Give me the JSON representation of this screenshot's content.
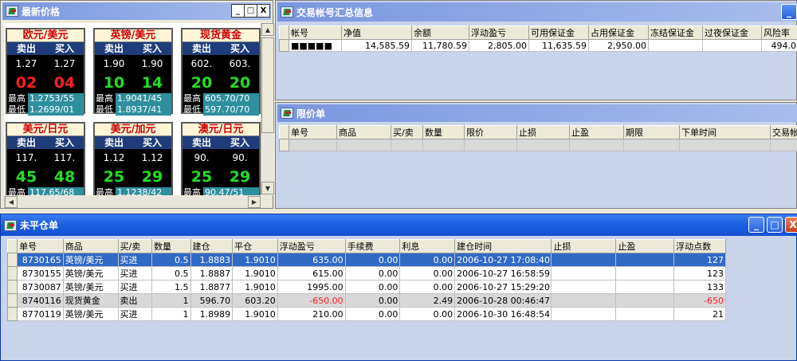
{
  "price_window": {
    "title": "最新价格",
    "tiles": [
      {
        "name": "欧元/美元",
        "sell_label": "卖出",
        "buy_label": "买入",
        "sell": "1.27",
        "buy": "1.27",
        "sell_pips": "02",
        "buy_pips": "04",
        "pips_color": "red",
        "high_label": "最高",
        "high": "1.2753/55",
        "low_label": "最低",
        "low": "1.2699/01"
      },
      {
        "name": "英镑/美元",
        "sell_label": "卖出",
        "buy_label": "买入",
        "sell": "1.90",
        "buy": "1.90",
        "sell_pips": "10",
        "buy_pips": "14",
        "pips_color": "green",
        "high_label": "最高",
        "high": "1.9041/45",
        "low_label": "最低",
        "low": "1.8937/41"
      },
      {
        "name": "现货黄金",
        "sell_label": "卖出",
        "buy_label": "买入",
        "sell": "602.",
        "buy": "603.",
        "sell_pips": "20",
        "buy_pips": "20",
        "pips_color": "green",
        "high_label": "最高",
        "high": "605.70/70",
        "low_label": "最低",
        "low": "597.70/70"
      },
      {
        "name": "美元/日元",
        "sell_label": "卖出",
        "buy_label": "买入",
        "sell": "117.",
        "buy": "117.",
        "sell_pips": "45",
        "buy_pips": "48",
        "pips_color": "green",
        "high_label": "最高",
        "high": "117.65/68",
        "low_label": "",
        "low": ""
      },
      {
        "name": "美元/加元",
        "sell_label": "卖出",
        "buy_label": "买入",
        "sell": "1.12",
        "buy": "1.12",
        "sell_pips": "25",
        "buy_pips": "29",
        "pips_color": "green",
        "high_label": "最高",
        "high": "1.1238/42",
        "low_label": "",
        "low": ""
      },
      {
        "name": "澳元/日元",
        "sell_label": "卖出",
        "buy_label": "买入",
        "sell": "90.",
        "buy": "90.",
        "sell_pips": "25",
        "buy_pips": "29",
        "pips_color": "green",
        "high_label": "最高",
        "high": "90.47/51",
        "low_label": "",
        "low": ""
      }
    ]
  },
  "account_window": {
    "title": "交易帐号汇总信息",
    "columns": [
      "帐号",
      "净值",
      "余额",
      "浮动盈亏",
      "可用保证金",
      "占用保证金",
      "冻结保证金",
      "过夜保证金",
      "风险率"
    ],
    "rows": [
      [
        "■■■■■",
        "14,585.59",
        "11,780.59",
        "2,805.00",
        "11,635.59",
        "2,950.00",
        "",
        "",
        "494.0"
      ]
    ]
  },
  "limit_window": {
    "title": "限价单",
    "columns": [
      "单号",
      "商品",
      "买/卖",
      "数量",
      "限价",
      "止损",
      "止盈",
      "期限",
      "下单时间",
      "交易帐"
    ],
    "rows": []
  },
  "open_window": {
    "title": "未平仓单",
    "columns": [
      "单号",
      "商品",
      "买/卖",
      "数量",
      "建仓",
      "平仓",
      "浮动盈亏",
      "手续费",
      "利息",
      "建仓时间",
      "止损",
      "止盈",
      "浮动点数"
    ],
    "rows": [
      [
        "8730165",
        "英镑/美元",
        "买进",
        "0.5",
        "1.8883",
        "1.9010",
        "635.00",
        "0.00",
        "0.00",
        "2006-10-27 17:08:40",
        "",
        "",
        "127"
      ],
      [
        "8730155",
        "英镑/美元",
        "买进",
        "0.5",
        "1.8887",
        "1.9010",
        "615.00",
        "0.00",
        "0.00",
        "2006-10-27 16:58:59",
        "",
        "",
        "123"
      ],
      [
        "8730087",
        "英镑/美元",
        "买进",
        "1.5",
        "1.8877",
        "1.9010",
        "1995.00",
        "0.00",
        "0.00",
        "2006-10-27 15:29:20",
        "",
        "",
        "133"
      ],
      [
        "8740116",
        "现货黄金",
        "卖出",
        "1",
        "596.70",
        "603.20",
        "-650.00",
        "0.00",
        "2.49",
        "2006-10-28 00:46:47",
        "",
        "",
        "-650"
      ],
      [
        "8770119",
        "英镑/美元",
        "买进",
        "1",
        "1.8989",
        "1.9010",
        "210.00",
        "0.00",
        "0.00",
        "2006-10-30 16:48:54",
        "",
        "",
        "21"
      ]
    ]
  },
  "controls": {
    "minimize": "_",
    "maximize": "□",
    "close": "X"
  },
  "colors": {
    "pips_red": "#ff2020",
    "pips_green": "#22e022",
    "selected_row": "#316ac5",
    "titlebar_active": "#1b5ee0",
    "titlebar_inactive": "#7a96df"
  }
}
